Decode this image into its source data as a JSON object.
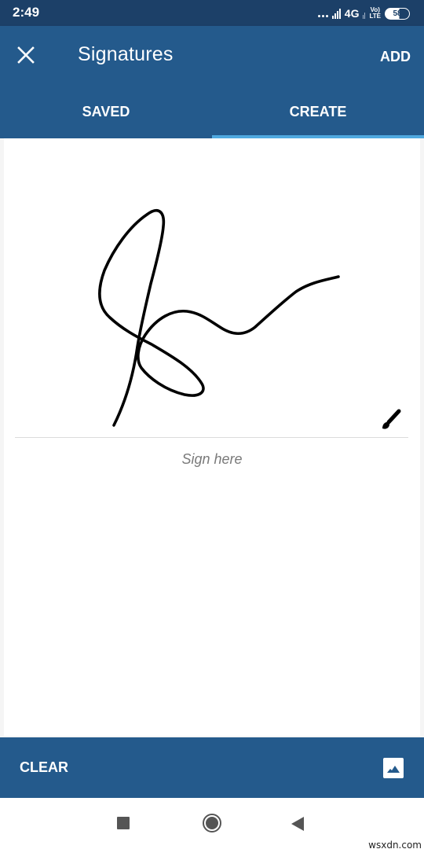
{
  "status_bar": {
    "time": "2:49",
    "network": "4G",
    "volte_top": "Vo)",
    "volte_bottom": "LTE",
    "battery": "58",
    "battery_level_percent": 58
  },
  "app_bar": {
    "title": "Signatures",
    "close_icon": "close-icon",
    "add_label": "ADD",
    "tabs": [
      {
        "label": "SAVED",
        "active": false
      },
      {
        "label": "CREATE",
        "active": true
      }
    ],
    "colors": {
      "primary": "#245a8c",
      "status": "#1c4068",
      "indicator": "#4fa9e0"
    }
  },
  "signature_pad": {
    "hint": "Sign here",
    "stroke_color": "#000000",
    "brush_icon": "brush-icon",
    "has_signature": true
  },
  "bottom_bar": {
    "clear_label": "CLEAR",
    "image_icon": "image-icon"
  },
  "nav_bar": {
    "recent_icon": "recent-apps-icon",
    "home_icon": "home-icon",
    "back_icon": "back-icon"
  },
  "watermark": "wsxdn.com"
}
